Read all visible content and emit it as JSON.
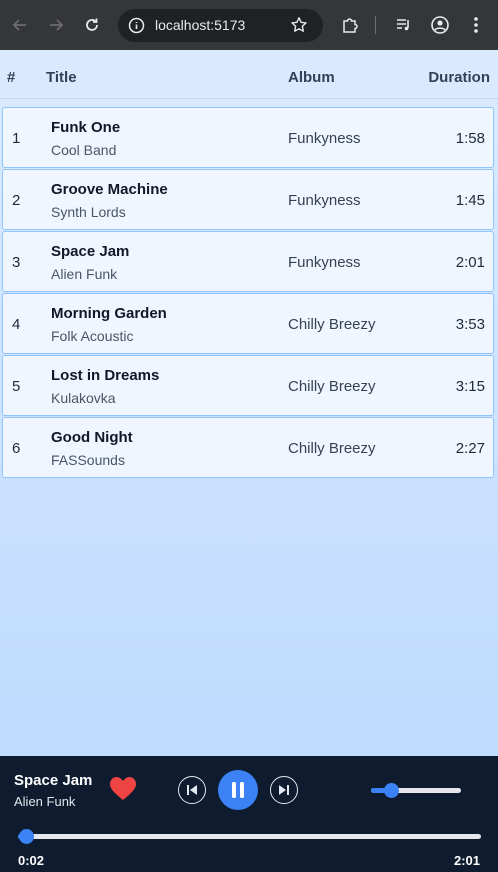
{
  "browser": {
    "url": "localhost:5173"
  },
  "table": {
    "headers": {
      "num": "#",
      "title": "Title",
      "album": "Album",
      "duration": "Duration"
    },
    "rows": [
      {
        "num": "1",
        "title": "Funk One",
        "artist": "Cool Band",
        "album": "Funkyness",
        "duration": "1:58"
      },
      {
        "num": "2",
        "title": "Groove Machine",
        "artist": "Synth Lords",
        "album": "Funkyness",
        "duration": "1:45"
      },
      {
        "num": "3",
        "title": "Space Jam",
        "artist": "Alien Funk",
        "album": "Funkyness",
        "duration": "2:01"
      },
      {
        "num": "4",
        "title": "Morning Garden",
        "artist": "Folk Acoustic",
        "album": "Chilly Breezy",
        "duration": "3:53"
      },
      {
        "num": "5",
        "title": "Lost in Dreams",
        "artist": "Kulakovka",
        "album": "Chilly Breezy",
        "duration": "3:15"
      },
      {
        "num": "6",
        "title": "Good Night",
        "artist": "FASSounds",
        "album": "Chilly Breezy",
        "duration": "2:27"
      }
    ]
  },
  "player": {
    "title": "Space Jam",
    "artist": "Alien Funk",
    "liked": true,
    "state": "playing",
    "current_time": "0:02",
    "total_time": "2:01",
    "progress_fraction": 0.017,
    "volume_fraction": 0.22,
    "accent_color": "#3b82f6",
    "heart_color": "#ef4444"
  }
}
